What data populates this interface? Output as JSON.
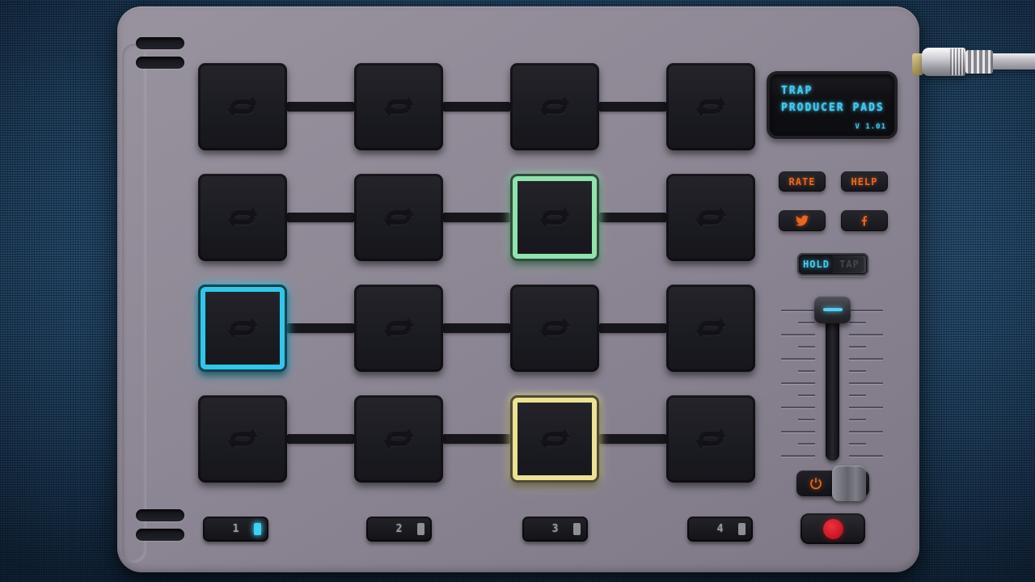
{
  "display": {
    "line1": "TRAP",
    "line2": "PRODUCER PADS",
    "version": "V 1.01"
  },
  "buttons": {
    "rate": "RATE",
    "help": "HELP"
  },
  "icons": {
    "twitter": "twitter-bird-icon",
    "facebook": "facebook-f-icon",
    "power": "power-icon",
    "record": "record-dot-icon",
    "pad_glyph": "loop-arrows-icon"
  },
  "mode_toggle": {
    "options": [
      "HOLD",
      "TAP"
    ],
    "selected": "HOLD"
  },
  "volume_slider": {
    "position": "top"
  },
  "banks": [
    {
      "label": "1",
      "active": true,
      "indicator_color": "#3fd0f2"
    },
    {
      "label": "2",
      "active": false,
      "indicator_color": "#8f8f96"
    },
    {
      "label": "3",
      "active": false,
      "indicator_color": "#8f8f96"
    },
    {
      "label": "4",
      "active": false,
      "indicator_color": "#8f8f96"
    }
  ],
  "pads": {
    "rows": 4,
    "cols": 4,
    "highlighted": [
      {
        "row": 2,
        "col": 3,
        "color": "#8fe3ae"
      },
      {
        "row": 3,
        "col": 1,
        "color": "#2fc7ea"
      },
      {
        "row": 4,
        "col": 3,
        "color": "#ece292"
      }
    ]
  },
  "colors": {
    "accent_cyan": "#45c9ee",
    "accent_orange": "#e8671e",
    "record_red": "#d81f2e",
    "device_body": "#8d8794",
    "background_blue": "#2b5578"
  }
}
